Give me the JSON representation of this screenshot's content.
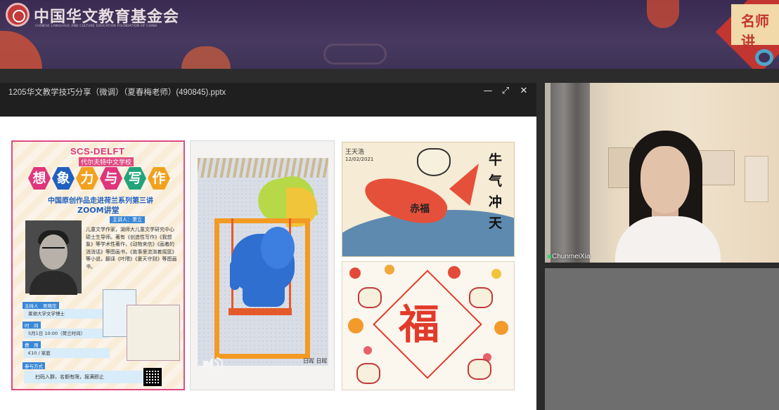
{
  "banner": {
    "org_name_cn": "中国华文教育基金会",
    "org_name_en": "CHINESE LANGUAGE AND CULTURE EDUCATION FOUNDATION OF CHINA",
    "badge_text": "名师讲"
  },
  "ppt_window": {
    "title": "1205华文教学技巧分享（微调）（夏春梅老师）(490845).pptx",
    "controls": {
      "minimize": "—",
      "restore": "⤢",
      "close": "✕"
    }
  },
  "poster": {
    "scs": "SCS-DELFT",
    "school": "代尔夫特中文学校",
    "hex_chars": [
      "想",
      "象",
      "力",
      "与",
      "写",
      "作"
    ],
    "subtitle": "中国原创作品走进荷兰系列第三讲",
    "zoom": "ZOOM讲堂",
    "speaker_label": "主讲人：萧立",
    "bio": "儿童文学作家，湖师大儿童文学研究中心硕士生导师。著有《创造性写作》《我想象》等学术性著作，《动物来信》《画着的消消话》等图画书，《故事里流淌着摇篮》等小说，翻译《叶隈》《夏天守则》等图画书。",
    "host_label": "主持人　吴晓华",
    "host_value": "莱顿大学文学博士",
    "time_label": "时　间",
    "time_value": "5月1日 10:00（荷兰时间）",
    "fee_label": "费　用",
    "fee_value": "€10 / 家庭",
    "join_label": "参与方式",
    "join_value": "扫码入群，名额有限，报满即止"
  },
  "elephant": {
    "signature": "日晖 日晖"
  },
  "fish": {
    "name": "王天浩",
    "date": "12/02/2021",
    "fu": "赤福",
    "vertical": [
      "牛",
      "气",
      "冲",
      "天"
    ]
  },
  "fu_panel": {
    "char": "福"
  },
  "webcam": {
    "participant_name": "ChunmeiXia"
  },
  "colors": {
    "banner": "#3e3357",
    "accent_red": "#c33530",
    "poster_pink": "#e04a82",
    "poster_blue": "#1f5fbf"
  }
}
